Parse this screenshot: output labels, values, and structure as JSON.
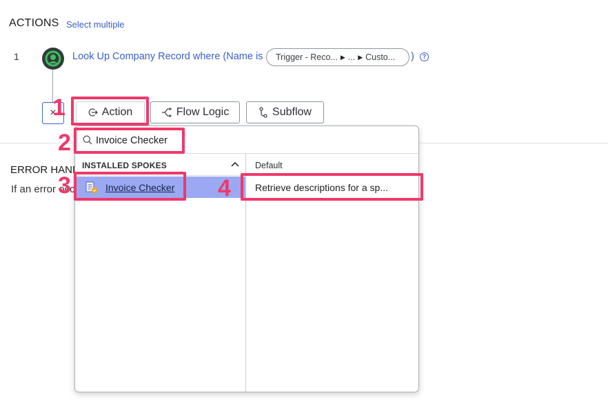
{
  "header": {
    "title": "ACTIONS",
    "select_multiple": "Select multiple"
  },
  "step": {
    "number": "1",
    "text": "Look Up Company Record where (Name is",
    "pill_part1": "Trigger - Reco...",
    "pill_part2": "...",
    "pill_part3": "Custo...",
    "paren_close": ")",
    "help": "?"
  },
  "toolbar": {
    "close_label": "×",
    "action_label": "Action",
    "flow_logic_label": "Flow Logic",
    "subflow_label": "Subflow"
  },
  "error_handler": {
    "title": "ERROR HANDLER",
    "text": "If an error occurs"
  },
  "dropdown": {
    "search_value": "Invoice Checker",
    "left_header": "INSTALLED SPOKES",
    "right_header": "Default",
    "spokes": [
      {
        "label": "Invoice Checker"
      }
    ],
    "actions": [
      {
        "label": "Retrieve descriptions for a sp..."
      }
    ]
  },
  "annotations": {
    "n1": "1",
    "n2": "2",
    "n3": "3",
    "n4": "4",
    "color": "#f0386b"
  },
  "colors": {
    "link": "#3b61c9",
    "selected_row": "#9aa9f1",
    "step_icon": "#2f3b3a",
    "step_icon_ring": "#3fbf5d"
  }
}
